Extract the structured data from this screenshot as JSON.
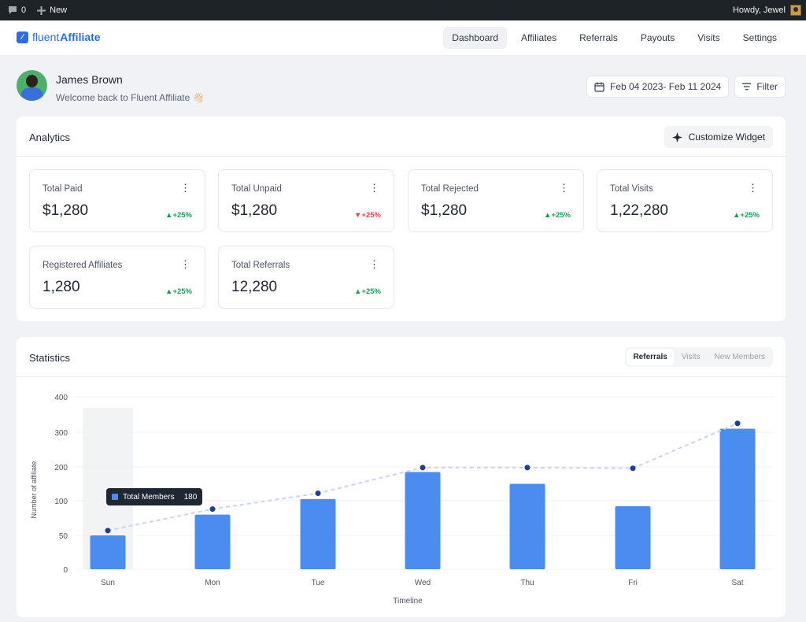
{
  "adminbar": {
    "comments_count": "0",
    "new_label": "New",
    "greeting": "Howdy, Jewel"
  },
  "brand": {
    "part1": "fluent",
    "part2": "Affiliate"
  },
  "nav": [
    "Dashboard",
    "Affiliates",
    "Referrals",
    "Payouts",
    "Visits",
    "Settings"
  ],
  "user": {
    "name": "James Brown",
    "welcome": "Welcome back to Fluent Affiliate 👋🏻"
  },
  "date_range": "Feb 04 2023- Feb 11 2024",
  "filter_label": "Filter",
  "analytics": {
    "title": "Analytics",
    "customize_label": "Customize Widget",
    "cards": [
      {
        "label": "Total Paid",
        "value": "$1,280",
        "change": "+25%",
        "trend": "up"
      },
      {
        "label": "Total Unpaid",
        "value": "$1,280",
        "change": "+25%",
        "trend": "down"
      },
      {
        "label": "Total Rejected",
        "value": "$1,280",
        "change": "+25%",
        "trend": "up"
      },
      {
        "label": "Total Visits",
        "value": "1,22,280",
        "change": "+25%",
        "trend": "up"
      },
      {
        "label": "Registered Affiliates",
        "value": "1,280",
        "change": "+25%",
        "trend": "up"
      },
      {
        "label": "Total Referrals",
        "value": "12,280",
        "change": "+25%",
        "trend": "up"
      }
    ]
  },
  "statistics": {
    "title": "Statistics",
    "tabs": [
      "Referrals",
      "Visits",
      "New Members"
    ],
    "tooltip": {
      "label": "Total Members",
      "value": "180"
    }
  },
  "colors": {
    "accent": "#2b6de8",
    "bar": "#4a8cf0",
    "line": "#c9d3f5",
    "dot": "#1f3c9a",
    "up": "#1e9a5b",
    "down": "#d9474b"
  },
  "chart_data": {
    "type": "bar",
    "categories": [
      "Sun",
      "Mon",
      "Tue",
      "Wed",
      "Thu",
      "Fri",
      "Sat"
    ],
    "series": [
      {
        "type": "bar",
        "values": [
          50,
          80,
          105,
          185,
          150,
          92,
          310
        ]
      },
      {
        "type": "line",
        "style": "dashed",
        "values": [
          57,
          88,
          122,
          198,
          198,
          196,
          325
        ]
      }
    ],
    "yticks": [
      0,
      50,
      100,
      200,
      300,
      400
    ],
    "xlabel": "Timeline",
    "ylabel": "Number of affiliate",
    "highlight_category": "Sun",
    "grid": true
  }
}
